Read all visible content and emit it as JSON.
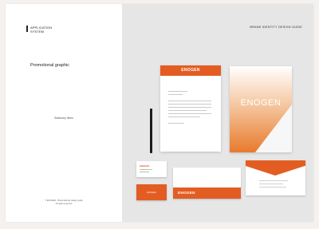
{
  "left_panel": {
    "section_title": "APPLICATION\nSYSTEM",
    "subtitle": "Promotional graphic",
    "item_label": "Stationery Items",
    "footer_text": "© ENOGEN · Brand identity design guide\nAll rights reserved"
  },
  "right_panel": {
    "guide_title": "BRAND IDENTITY DESIGN GUIDE",
    "brand_name": "ENOGEN",
    "letterhead_logo": "ENOGEN",
    "card_front_text": "ENOGEN",
    "card_back_text": "ENOGEN",
    "envelope_text": "ENOGEN"
  },
  "colors": {
    "accent": "#e35d22",
    "panel_gray": "#e6e6e6"
  }
}
